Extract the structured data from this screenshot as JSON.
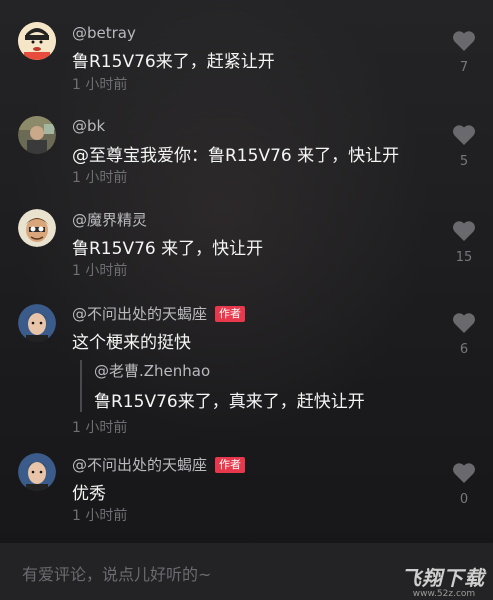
{
  "comments": [
    {
      "username": "@betray",
      "text": "鲁R15V76来了，赶紧让开",
      "time": "1 小时前",
      "likes": "7",
      "avatar": "cartoon-boy-avatar"
    },
    {
      "username": "@bk",
      "text": "@至尊宝我爱你：鲁R15V76 来了，快让开",
      "time": "1 小时前",
      "likes": "5",
      "avatar": "photo-avatar"
    },
    {
      "username": "@魔界精灵",
      "text": "鲁R15V76 来了，快让开",
      "time": "1 小时前",
      "likes": "15",
      "avatar": "cartoon-old-man-avatar"
    },
    {
      "username": "@不问出处的天蝎座",
      "badge": "作者",
      "text": "这个梗来的挺快",
      "reply_user": "@老曹.Zhenhao",
      "reply_text": "鲁R15V76来了，真来了，赶快让开",
      "time": "1 小时前",
      "likes": "6",
      "avatar": "selfie-avatar"
    },
    {
      "username": "@不问出处的天蝎座",
      "badge": "作者",
      "text": "优秀",
      "time": "1 小时前",
      "likes": "0",
      "avatar": "selfie-avatar"
    }
  ],
  "input": {
    "placeholder": "有爱评论，说点儿好听的~"
  },
  "watermark": {
    "title": "飞翔下载",
    "url": "www.52z.com"
  },
  "colors": {
    "background": "#1c1c1e",
    "author_badge": "#e8384b",
    "muted_text": "#6e6e73"
  }
}
